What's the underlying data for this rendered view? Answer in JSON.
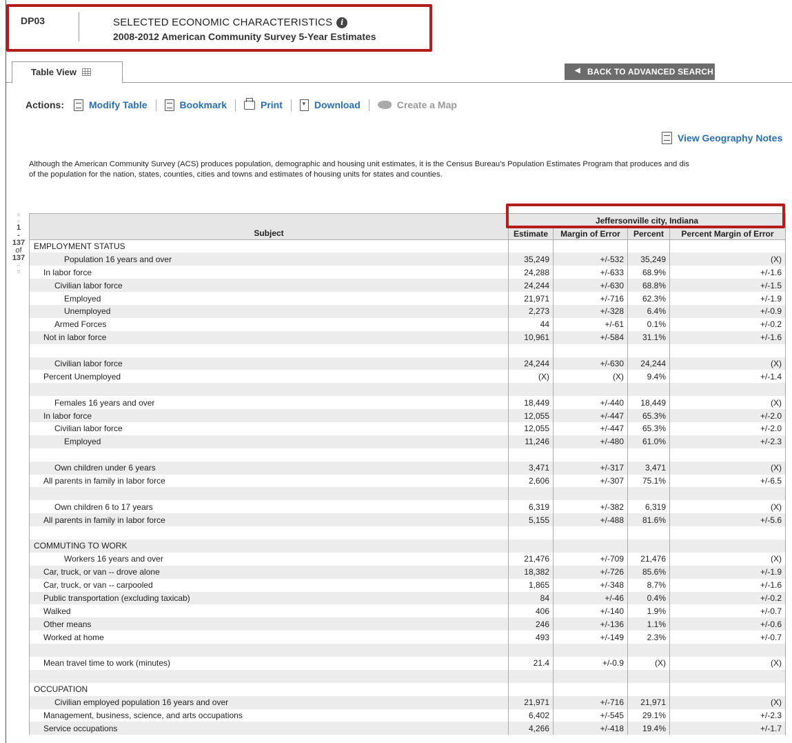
{
  "header": {
    "code": "DP03",
    "title": "SELECTED ECONOMIC CHARACTERISTICS",
    "info_icon": "i",
    "subtitle": "2008-2012 American Community Survey 5-Year Estimates"
  },
  "tabs": {
    "table_view": "Table View"
  },
  "back_button": {
    "arrow": "◀",
    "label": "BACK TO ADVANCED SEARCH"
  },
  "actions": {
    "label": "Actions:",
    "modify": "Modify Table",
    "bookmark": "Bookmark",
    "print": "Print",
    "download": "Download",
    "map": "Create a Map"
  },
  "geo_notes": "View Geography Notes",
  "note": "Although the American Community Survey (ACS) produces population, demographic and housing unit estimates, it is the Census Bureau's Population Estimates Program that produces and dis\nof the population for the nation, states, counties, cities and towns and estimates of housing units for states and counties.",
  "pager": {
    "up2": "«",
    "up1": "‹",
    "current": "1",
    "dash": "-",
    "end": "137",
    "of": "of",
    "total": "137",
    "down1": "›",
    "down2": "»"
  },
  "table": {
    "geography": "Jeffersonville city, Indiana",
    "columns": [
      "Subject",
      "Estimate",
      "Margin of Error",
      "Percent",
      "Percent Margin of Error"
    ],
    "rows": [
      {
        "s": "EMPLOYMENT STATUS",
        "l": 0,
        "e": "",
        "m": "",
        "p": "",
        "pm": ""
      },
      {
        "s": "Population 16 years and over",
        "l": 3,
        "e": "35,249",
        "m": "+/-532",
        "p": "35,249",
        "pm": "(X)"
      },
      {
        "s": "In labor force",
        "l": 1,
        "e": "24,288",
        "m": "+/-633",
        "p": "68.9%",
        "pm": "+/-1.6"
      },
      {
        "s": "Civilian labor force",
        "l": 2,
        "e": "24,244",
        "m": "+/-630",
        "p": "68.8%",
        "pm": "+/-1.5"
      },
      {
        "s": "Employed",
        "l": 3,
        "e": "21,971",
        "m": "+/-716",
        "p": "62.3%",
        "pm": "+/-1.9"
      },
      {
        "s": "Unemployed",
        "l": 3,
        "e": "2,273",
        "m": "+/-328",
        "p": "6.4%",
        "pm": "+/-0.9"
      },
      {
        "s": "Armed Forces",
        "l": 2,
        "e": "44",
        "m": "+/-61",
        "p": "0.1%",
        "pm": "+/-0.2"
      },
      {
        "s": "Not in labor force",
        "l": 1,
        "e": "10,961",
        "m": "+/-584",
        "p": "31.1%",
        "pm": "+/-1.6"
      },
      {
        "s": "",
        "l": 0,
        "e": "",
        "m": "",
        "p": "",
        "pm": ""
      },
      {
        "s": "Civilian labor force",
        "l": 2,
        "e": "24,244",
        "m": "+/-630",
        "p": "24,244",
        "pm": "(X)"
      },
      {
        "s": "Percent Unemployed",
        "l": 1,
        "e": "(X)",
        "m": "(X)",
        "p": "9.4%",
        "pm": "+/-1.4"
      },
      {
        "s": "",
        "l": 0,
        "e": "",
        "m": "",
        "p": "",
        "pm": ""
      },
      {
        "s": "Females 16 years and over",
        "l": 2,
        "e": "18,449",
        "m": "+/-440",
        "p": "18,449",
        "pm": "(X)"
      },
      {
        "s": "In labor force",
        "l": 1,
        "e": "12,055",
        "m": "+/-447",
        "p": "65.3%",
        "pm": "+/-2.0"
      },
      {
        "s": "Civilian labor force",
        "l": 2,
        "e": "12,055",
        "m": "+/-447",
        "p": "65.3%",
        "pm": "+/-2.0"
      },
      {
        "s": "Employed",
        "l": 3,
        "e": "11,246",
        "m": "+/-480",
        "p": "61.0%",
        "pm": "+/-2.3"
      },
      {
        "s": "",
        "l": 0,
        "e": "",
        "m": "",
        "p": "",
        "pm": ""
      },
      {
        "s": "Own children under 6 years",
        "l": 2,
        "e": "3,471",
        "m": "+/-317",
        "p": "3,471",
        "pm": "(X)"
      },
      {
        "s": "All parents in family in labor force",
        "l": 1,
        "e": "2,606",
        "m": "+/-307",
        "p": "75.1%",
        "pm": "+/-6.5"
      },
      {
        "s": "",
        "l": 0,
        "e": "",
        "m": "",
        "p": "",
        "pm": ""
      },
      {
        "s": "Own children 6 to 17 years",
        "l": 2,
        "e": "6,319",
        "m": "+/-382",
        "p": "6,319",
        "pm": "(X)"
      },
      {
        "s": "All parents in family in labor force",
        "l": 1,
        "e": "5,155",
        "m": "+/-488",
        "p": "81.6%",
        "pm": "+/-5.6"
      },
      {
        "s": "",
        "l": 0,
        "e": "",
        "m": "",
        "p": "",
        "pm": ""
      },
      {
        "s": "COMMUTING TO WORK",
        "l": 0,
        "e": "",
        "m": "",
        "p": "",
        "pm": ""
      },
      {
        "s": "Workers 16 years and over",
        "l": 3,
        "e": "21,476",
        "m": "+/-709",
        "p": "21,476",
        "pm": "(X)"
      },
      {
        "s": "Car, truck, or van -- drove alone",
        "l": 1,
        "e": "18,382",
        "m": "+/-726",
        "p": "85.6%",
        "pm": "+/-1.9"
      },
      {
        "s": "Car, truck, or van -- carpooled",
        "l": 1,
        "e": "1,865",
        "m": "+/-348",
        "p": "8.7%",
        "pm": "+/-1.6"
      },
      {
        "s": "Public transportation (excluding taxicab)",
        "l": 1,
        "e": "84",
        "m": "+/-46",
        "p": "0.4%",
        "pm": "+/-0.2"
      },
      {
        "s": "Walked",
        "l": 1,
        "e": "406",
        "m": "+/-140",
        "p": "1.9%",
        "pm": "+/-0.7"
      },
      {
        "s": "Other means",
        "l": 1,
        "e": "246",
        "m": "+/-136",
        "p": "1.1%",
        "pm": "+/-0.6"
      },
      {
        "s": "Worked at home",
        "l": 1,
        "e": "493",
        "m": "+/-149",
        "p": "2.3%",
        "pm": "+/-0.7"
      },
      {
        "s": "",
        "l": 0,
        "e": "",
        "m": "",
        "p": "",
        "pm": ""
      },
      {
        "s": "Mean travel time to work (minutes)",
        "l": 1,
        "e": "21.4",
        "m": "+/-0.9",
        "p": "(X)",
        "pm": "(X)"
      },
      {
        "s": "",
        "l": 0,
        "e": "",
        "m": "",
        "p": "",
        "pm": ""
      },
      {
        "s": "OCCUPATION",
        "l": 0,
        "e": "",
        "m": "",
        "p": "",
        "pm": ""
      },
      {
        "s": "Civilian employed population 16 years and over",
        "l": 2,
        "e": "21,971",
        "m": "+/-716",
        "p": "21,971",
        "pm": "(X)"
      },
      {
        "s": "Management, business, science, and arts occupations",
        "l": 1,
        "e": "6,402",
        "m": "+/-545",
        "p": "29.1%",
        "pm": "+/-2.3"
      },
      {
        "s": "Service occupations",
        "l": 1,
        "e": "4,266",
        "m": "+/-418",
        "p": "19.4%",
        "pm": "+/-1.7"
      }
    ]
  }
}
